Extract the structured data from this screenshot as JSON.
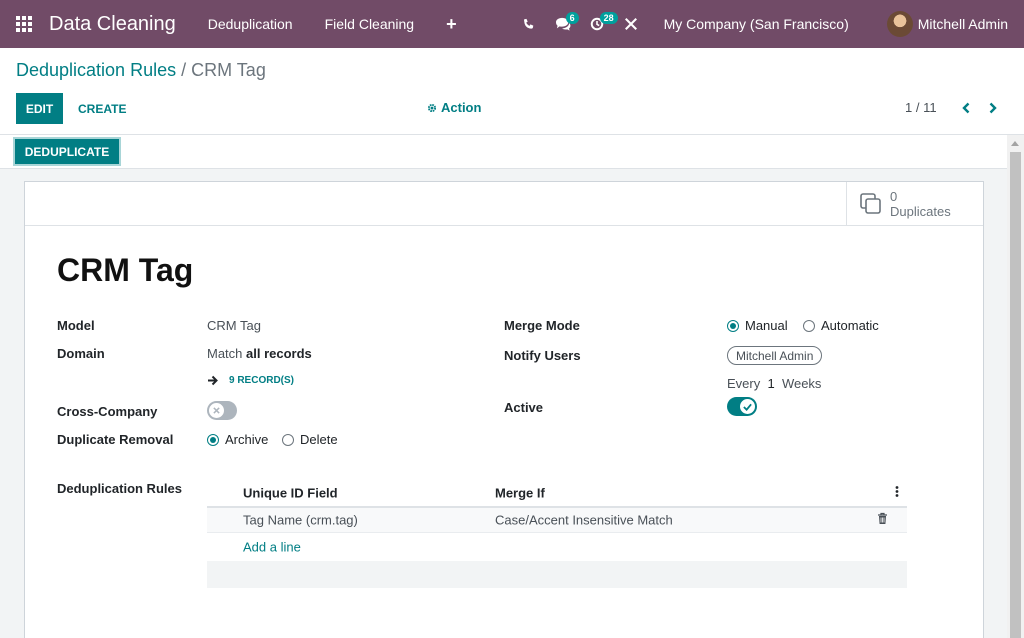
{
  "navbar": {
    "app_title": "Data Cleaning",
    "menus": [
      "Deduplication",
      "Field Cleaning"
    ],
    "messages_count": "6",
    "activities_count": "28",
    "company": "My Company (San Francisco)",
    "user": "Mitchell Admin"
  },
  "breadcrumb": {
    "parent": "Deduplication Rules",
    "separator": "/",
    "current": "CRM Tag"
  },
  "toolbar": {
    "edit_label": "EDIT",
    "create_label": "CREATE",
    "action_label": "Action",
    "pager": "1 / 11"
  },
  "statusbar": {
    "deduplicate_label": "DEDUPLICATE"
  },
  "stat_button": {
    "count": "0",
    "label": "Duplicates"
  },
  "form": {
    "title": "CRM Tag",
    "model_label": "Model",
    "model_value": "CRM Tag",
    "domain_label": "Domain",
    "domain_prefix": "Match",
    "domain_value": "all records",
    "records_link": "9 RECORD(S)",
    "cross_company_label": "Cross-Company",
    "cross_company_on": false,
    "duplicate_removal_label": "Duplicate Removal",
    "removal_options": [
      {
        "label": "Archive",
        "selected": true
      },
      {
        "label": "Delete",
        "selected": false
      }
    ],
    "merge_mode_label": "Merge Mode",
    "merge_options": [
      {
        "label": "Manual",
        "selected": true
      },
      {
        "label": "Automatic",
        "selected": false
      }
    ],
    "notify_users_label": "Notify Users",
    "notify_user_tag": "Mitchell Admin",
    "notify_every": "Every",
    "notify_interval": "1",
    "notify_unit": "Weeks",
    "active_label": "Active",
    "active_on": true,
    "rules_label": "Deduplication Rules"
  },
  "rules_table": {
    "columns": [
      "Unique ID Field",
      "Merge If"
    ],
    "rows": [
      {
        "field": "Tag Name (crm.tag)",
        "merge_if": "Case/Accent Insensitive Match"
      }
    ],
    "add_line": "Add a line"
  },
  "colors": {
    "navbar": "#714b67",
    "primary": "#017e84",
    "badge": "#00a09d"
  }
}
